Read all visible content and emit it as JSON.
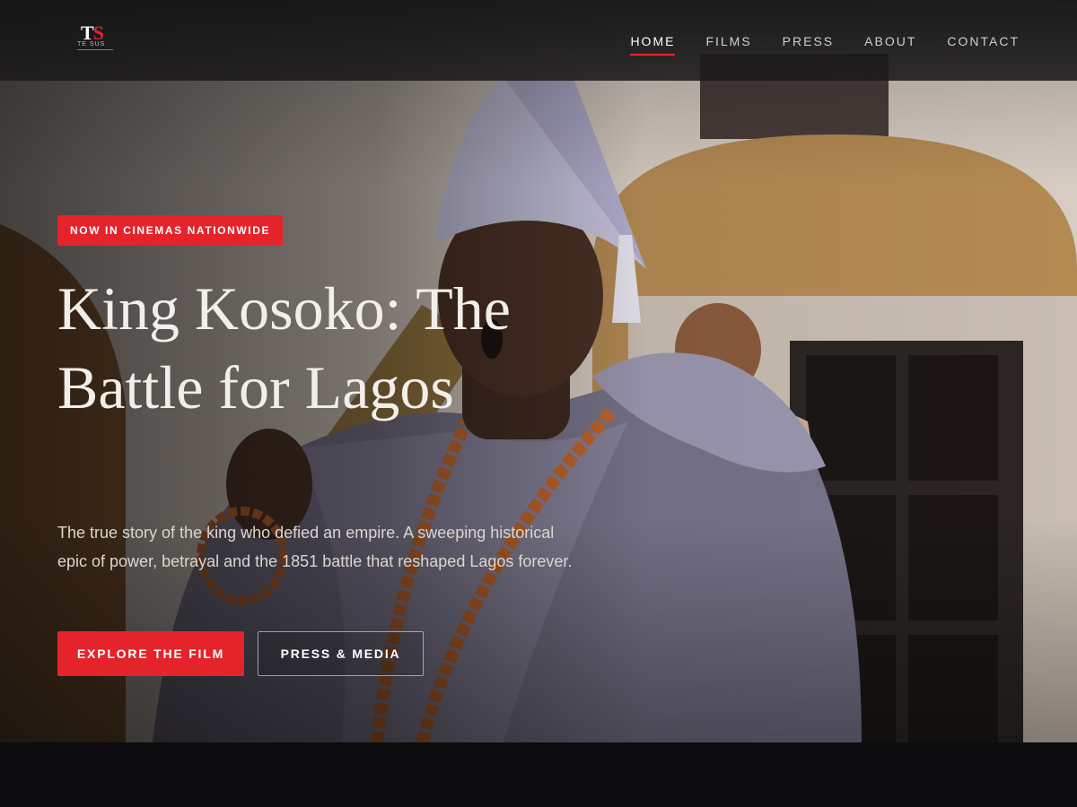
{
  "brand": {
    "logo_mark_t": "T",
    "logo_mark_s": "S",
    "logo_sub": "TE  SUS",
    "accent_color": "#e4232b"
  },
  "nav": {
    "items": [
      {
        "label": "HOME",
        "active": true
      },
      {
        "label": "FILMS",
        "active": false
      },
      {
        "label": "PRESS",
        "active": false
      },
      {
        "label": "ABOUT",
        "active": false
      },
      {
        "label": "CONTACT",
        "active": false
      }
    ]
  },
  "hero": {
    "badge": "NOW IN CINEMAS NATIONWIDE",
    "title": "King Kosoko: The Battle for Lagos",
    "tagline": "The true story of the king who defied an empire. A sweeping historical epic of power, betrayal and the 1851 battle that reshaped Lagos forever.",
    "primary_button": "EXPLORE THE FILM",
    "secondary_button": "PRESS & MEDIA"
  }
}
